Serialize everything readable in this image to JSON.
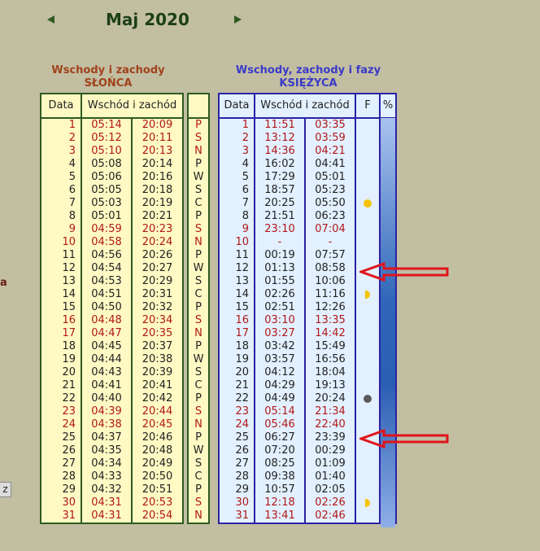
{
  "month_title": "Maj 2020",
  "sun": {
    "heading_line1": "Wschody i zachody",
    "heading_line2": "SŁOŃCA",
    "col_date": "Data",
    "col_rise_set": "Wschód i zachód"
  },
  "moon": {
    "heading_line1": "Wschody, zachody i fazy",
    "heading_line2": "KSIĘŻYCA",
    "col_date": "Data",
    "col_rise_set": "Wschód i zachód",
    "col_phase": "F",
    "col_pct": "%"
  },
  "left_fragment": "a",
  "side_button": "z",
  "colors": {
    "weekend": "#b01818",
    "sun_border": "#2e5a1f",
    "moon_border": "#2a23a6",
    "annotation_arrow": "#e0141a"
  },
  "days": [
    {
      "d": "1",
      "sr": "05:14",
      "ss": "20:09",
      "w": "P",
      "mr": "11:51",
      "ms": "03:35",
      "red": true,
      "phase": ""
    },
    {
      "d": "2",
      "sr": "05:12",
      "ss": "20:11",
      "w": "S",
      "mr": "13:12",
      "ms": "03:59",
      "red": true,
      "phase": ""
    },
    {
      "d": "3",
      "sr": "05:10",
      "ss": "20:13",
      "w": "N",
      "mr": "14:36",
      "ms": "04:21",
      "red": true,
      "phase": ""
    },
    {
      "d": "4",
      "sr": "05:08",
      "ss": "20:14",
      "w": "P",
      "mr": "16:02",
      "ms": "04:41",
      "red": false,
      "phase": ""
    },
    {
      "d": "5",
      "sr": "05:06",
      "ss": "20:16",
      "w": "W",
      "mr": "17:29",
      "ms": "05:01",
      "red": false,
      "phase": ""
    },
    {
      "d": "6",
      "sr": "05:05",
      "ss": "20:18",
      "w": "S",
      "mr": "18:57",
      "ms": "05:23",
      "red": false,
      "phase": ""
    },
    {
      "d": "7",
      "sr": "05:03",
      "ss": "20:19",
      "w": "C",
      "mr": "20:25",
      "ms": "05:50",
      "red": false,
      "phase": "full-moon-icon"
    },
    {
      "d": "8",
      "sr": "05:01",
      "ss": "20:21",
      "w": "P",
      "mr": "21:51",
      "ms": "06:23",
      "red": false,
      "phase": ""
    },
    {
      "d": "9",
      "sr": "04:59",
      "ss": "20:23",
      "w": "S",
      "mr": "23:10",
      "ms": "07:04",
      "red": true,
      "phase": ""
    },
    {
      "d": "10",
      "sr": "04:58",
      "ss": "20:24",
      "w": "N",
      "mr": "-",
      "ms": "-",
      "red": true,
      "phase": ""
    },
    {
      "d": "11",
      "sr": "04:56",
      "ss": "20:26",
      "w": "P",
      "mr": "00:19",
      "ms": "07:57",
      "red": false,
      "phase": ""
    },
    {
      "d": "12",
      "sr": "04:54",
      "ss": "20:27",
      "w": "W",
      "mr": "01:13",
      "ms": "08:58",
      "red": false,
      "phase": ""
    },
    {
      "d": "13",
      "sr": "04:53",
      "ss": "20:29",
      "w": "S",
      "mr": "01:55",
      "ms": "10:06",
      "red": false,
      "phase": ""
    },
    {
      "d": "14",
      "sr": "04:51",
      "ss": "20:31",
      "w": "C",
      "mr": "02:26",
      "ms": "11:16",
      "red": false,
      "phase": "last-quarter-icon"
    },
    {
      "d": "15",
      "sr": "04:50",
      "ss": "20:32",
      "w": "P",
      "mr": "02:51",
      "ms": "12:26",
      "red": false,
      "phase": ""
    },
    {
      "d": "16",
      "sr": "04:48",
      "ss": "20:34",
      "w": "S",
      "mr": "03:10",
      "ms": "13:35",
      "red": true,
      "phase": ""
    },
    {
      "d": "17",
      "sr": "04:47",
      "ss": "20:35",
      "w": "N",
      "mr": "03:27",
      "ms": "14:42",
      "red": true,
      "phase": ""
    },
    {
      "d": "18",
      "sr": "04:45",
      "ss": "20:37",
      "w": "P",
      "mr": "03:42",
      "ms": "15:49",
      "red": false,
      "phase": ""
    },
    {
      "d": "19",
      "sr": "04:44",
      "ss": "20:38",
      "w": "W",
      "mr": "03:57",
      "ms": "16:56",
      "red": false,
      "phase": ""
    },
    {
      "d": "20",
      "sr": "04:43",
      "ss": "20:39",
      "w": "S",
      "mr": "04:12",
      "ms": "18:04",
      "red": false,
      "phase": ""
    },
    {
      "d": "21",
      "sr": "04:41",
      "ss": "20:41",
      "w": "C",
      "mr": "04:29",
      "ms": "19:13",
      "red": false,
      "phase": ""
    },
    {
      "d": "22",
      "sr": "04:40",
      "ss": "20:42",
      "w": "P",
      "mr": "04:49",
      "ms": "20:24",
      "red": false,
      "phase": "new-moon-icon"
    },
    {
      "d": "23",
      "sr": "04:39",
      "ss": "20:44",
      "w": "S",
      "mr": "05:14",
      "ms": "21:34",
      "red": true,
      "phase": ""
    },
    {
      "d": "24",
      "sr": "04:38",
      "ss": "20:45",
      "w": "N",
      "mr": "05:46",
      "ms": "22:40",
      "red": true,
      "phase": ""
    },
    {
      "d": "25",
      "sr": "04:37",
      "ss": "20:46",
      "w": "P",
      "mr": "06:27",
      "ms": "23:39",
      "red": false,
      "phase": ""
    },
    {
      "d": "26",
      "sr": "04:35",
      "ss": "20:48",
      "w": "W",
      "mr": "07:20",
      "ms": "00:29",
      "red": false,
      "phase": ""
    },
    {
      "d": "27",
      "sr": "04:34",
      "ss": "20:49",
      "w": "S",
      "mr": "08:25",
      "ms": "01:09",
      "red": false,
      "phase": ""
    },
    {
      "d": "28",
      "sr": "04:33",
      "ss": "20:50",
      "w": "C",
      "mr": "09:38",
      "ms": "01:40",
      "red": false,
      "phase": ""
    },
    {
      "d": "29",
      "sr": "04:32",
      "ss": "20:51",
      "w": "P",
      "mr": "10:57",
      "ms": "02:05",
      "red": false,
      "phase": ""
    },
    {
      "d": "30",
      "sr": "04:31",
      "ss": "20:53",
      "w": "S",
      "mr": "12:18",
      "ms": "02:26",
      "red": true,
      "phase": "first-quarter-icon"
    },
    {
      "d": "31",
      "sr": "04:31",
      "ss": "20:54",
      "w": "N",
      "mr": "13:41",
      "ms": "02:46",
      "red": true,
      "phase": ""
    }
  ]
}
